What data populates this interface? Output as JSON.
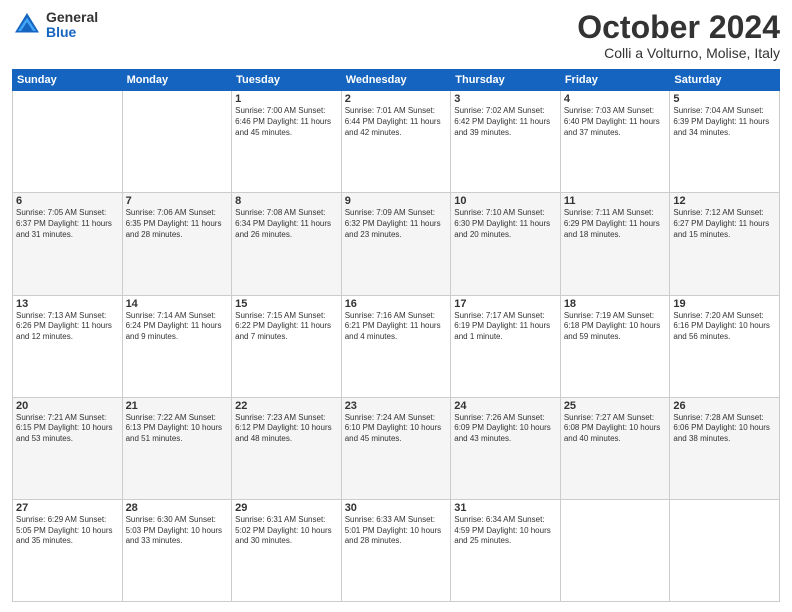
{
  "header": {
    "logo_general": "General",
    "logo_blue": "Blue",
    "title": "October 2024",
    "location": "Colli a Volturno, Molise, Italy"
  },
  "weekdays": [
    "Sunday",
    "Monday",
    "Tuesday",
    "Wednesday",
    "Thursday",
    "Friday",
    "Saturday"
  ],
  "weeks": [
    [
      {
        "day": "",
        "info": ""
      },
      {
        "day": "",
        "info": ""
      },
      {
        "day": "1",
        "info": "Sunrise: 7:00 AM\nSunset: 6:46 PM\nDaylight: 11 hours and 45 minutes."
      },
      {
        "day": "2",
        "info": "Sunrise: 7:01 AM\nSunset: 6:44 PM\nDaylight: 11 hours and 42 minutes."
      },
      {
        "day": "3",
        "info": "Sunrise: 7:02 AM\nSunset: 6:42 PM\nDaylight: 11 hours and 39 minutes."
      },
      {
        "day": "4",
        "info": "Sunrise: 7:03 AM\nSunset: 6:40 PM\nDaylight: 11 hours and 37 minutes."
      },
      {
        "day": "5",
        "info": "Sunrise: 7:04 AM\nSunset: 6:39 PM\nDaylight: 11 hours and 34 minutes."
      }
    ],
    [
      {
        "day": "6",
        "info": "Sunrise: 7:05 AM\nSunset: 6:37 PM\nDaylight: 11 hours and 31 minutes."
      },
      {
        "day": "7",
        "info": "Sunrise: 7:06 AM\nSunset: 6:35 PM\nDaylight: 11 hours and 28 minutes."
      },
      {
        "day": "8",
        "info": "Sunrise: 7:08 AM\nSunset: 6:34 PM\nDaylight: 11 hours and 26 minutes."
      },
      {
        "day": "9",
        "info": "Sunrise: 7:09 AM\nSunset: 6:32 PM\nDaylight: 11 hours and 23 minutes."
      },
      {
        "day": "10",
        "info": "Sunrise: 7:10 AM\nSunset: 6:30 PM\nDaylight: 11 hours and 20 minutes."
      },
      {
        "day": "11",
        "info": "Sunrise: 7:11 AM\nSunset: 6:29 PM\nDaylight: 11 hours and 18 minutes."
      },
      {
        "day": "12",
        "info": "Sunrise: 7:12 AM\nSunset: 6:27 PM\nDaylight: 11 hours and 15 minutes."
      }
    ],
    [
      {
        "day": "13",
        "info": "Sunrise: 7:13 AM\nSunset: 6:26 PM\nDaylight: 11 hours and 12 minutes."
      },
      {
        "day": "14",
        "info": "Sunrise: 7:14 AM\nSunset: 6:24 PM\nDaylight: 11 hours and 9 minutes."
      },
      {
        "day": "15",
        "info": "Sunrise: 7:15 AM\nSunset: 6:22 PM\nDaylight: 11 hours and 7 minutes."
      },
      {
        "day": "16",
        "info": "Sunrise: 7:16 AM\nSunset: 6:21 PM\nDaylight: 11 hours and 4 minutes."
      },
      {
        "day": "17",
        "info": "Sunrise: 7:17 AM\nSunset: 6:19 PM\nDaylight: 11 hours and 1 minute."
      },
      {
        "day": "18",
        "info": "Sunrise: 7:19 AM\nSunset: 6:18 PM\nDaylight: 10 hours and 59 minutes."
      },
      {
        "day": "19",
        "info": "Sunrise: 7:20 AM\nSunset: 6:16 PM\nDaylight: 10 hours and 56 minutes."
      }
    ],
    [
      {
        "day": "20",
        "info": "Sunrise: 7:21 AM\nSunset: 6:15 PM\nDaylight: 10 hours and 53 minutes."
      },
      {
        "day": "21",
        "info": "Sunrise: 7:22 AM\nSunset: 6:13 PM\nDaylight: 10 hours and 51 minutes."
      },
      {
        "day": "22",
        "info": "Sunrise: 7:23 AM\nSunset: 6:12 PM\nDaylight: 10 hours and 48 minutes."
      },
      {
        "day": "23",
        "info": "Sunrise: 7:24 AM\nSunset: 6:10 PM\nDaylight: 10 hours and 45 minutes."
      },
      {
        "day": "24",
        "info": "Sunrise: 7:26 AM\nSunset: 6:09 PM\nDaylight: 10 hours and 43 minutes."
      },
      {
        "day": "25",
        "info": "Sunrise: 7:27 AM\nSunset: 6:08 PM\nDaylight: 10 hours and 40 minutes."
      },
      {
        "day": "26",
        "info": "Sunrise: 7:28 AM\nSunset: 6:06 PM\nDaylight: 10 hours and 38 minutes."
      }
    ],
    [
      {
        "day": "27",
        "info": "Sunrise: 6:29 AM\nSunset: 5:05 PM\nDaylight: 10 hours and 35 minutes."
      },
      {
        "day": "28",
        "info": "Sunrise: 6:30 AM\nSunset: 5:03 PM\nDaylight: 10 hours and 33 minutes."
      },
      {
        "day": "29",
        "info": "Sunrise: 6:31 AM\nSunset: 5:02 PM\nDaylight: 10 hours and 30 minutes."
      },
      {
        "day": "30",
        "info": "Sunrise: 6:33 AM\nSunset: 5:01 PM\nDaylight: 10 hours and 28 minutes."
      },
      {
        "day": "31",
        "info": "Sunrise: 6:34 AM\nSunset: 4:59 PM\nDaylight: 10 hours and 25 minutes."
      },
      {
        "day": "",
        "info": ""
      },
      {
        "day": "",
        "info": ""
      }
    ]
  ]
}
